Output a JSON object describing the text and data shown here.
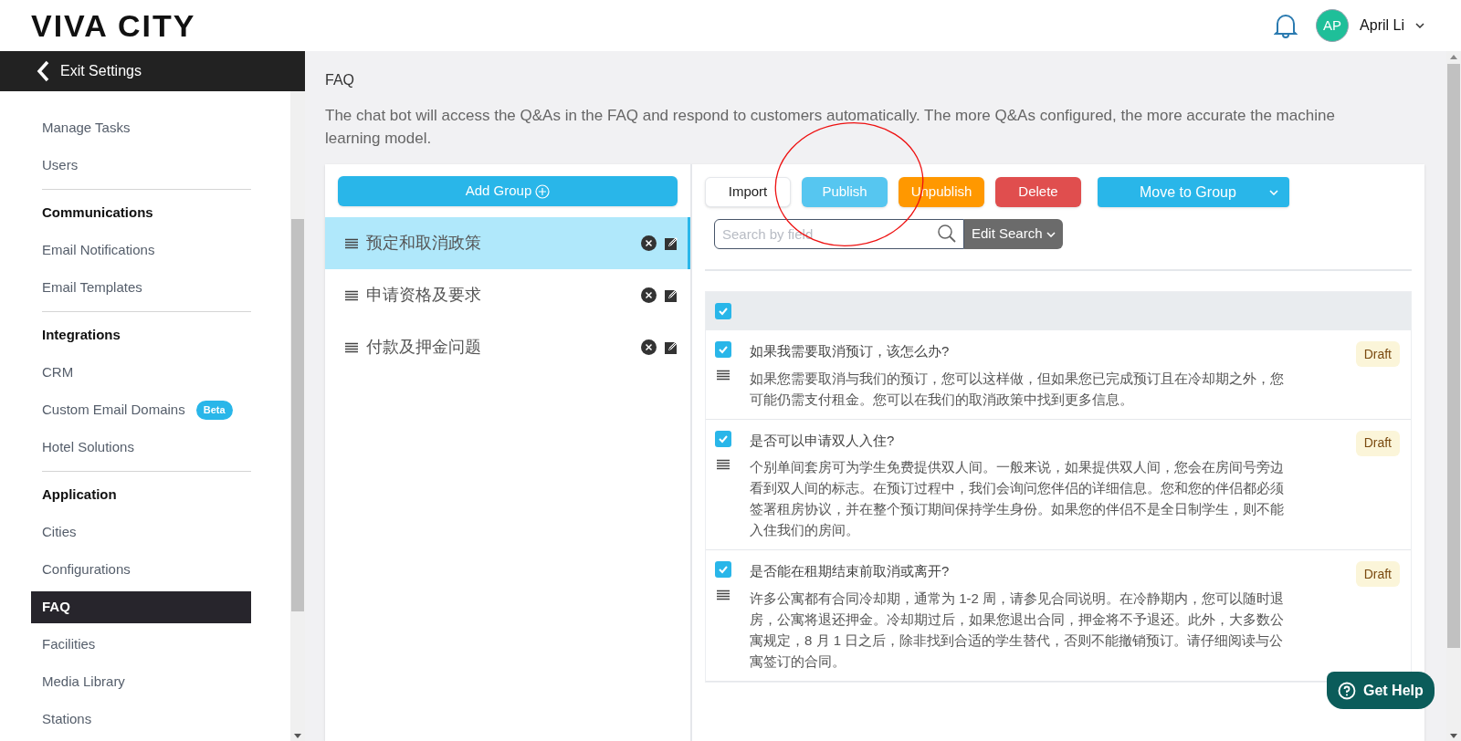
{
  "header": {
    "logo": "VIVA CITY",
    "user": {
      "initials": "AP",
      "name": "April Li"
    }
  },
  "sidebar": {
    "back": "Exit Settings",
    "items": [
      {
        "kind": "item",
        "label": "Manage Tasks",
        "selected": false
      },
      {
        "kind": "item",
        "label": "Users",
        "selected": false
      },
      {
        "kind": "divider"
      },
      {
        "kind": "heading",
        "label": "Communications"
      },
      {
        "kind": "item",
        "label": "Email Notifications",
        "selected": false
      },
      {
        "kind": "item",
        "label": "Email Templates",
        "selected": false
      },
      {
        "kind": "divider"
      },
      {
        "kind": "heading",
        "label": "Integrations"
      },
      {
        "kind": "item",
        "label": "CRM",
        "selected": false
      },
      {
        "kind": "item",
        "label": "Custom Email Domains",
        "badge": "Beta",
        "selected": false
      },
      {
        "kind": "item",
        "label": "Hotel Solutions",
        "selected": false
      },
      {
        "kind": "divider"
      },
      {
        "kind": "heading",
        "label": "Application"
      },
      {
        "kind": "item",
        "label": "Cities",
        "selected": false
      },
      {
        "kind": "item",
        "label": "Configurations",
        "selected": false
      },
      {
        "kind": "item",
        "label": "FAQ",
        "selected": true
      },
      {
        "kind": "item",
        "label": "Facilities",
        "selected": false
      },
      {
        "kind": "item",
        "label": "Media Library",
        "selected": false
      },
      {
        "kind": "item",
        "label": "Stations",
        "selected": false
      }
    ]
  },
  "page": {
    "title": "FAQ",
    "description": "The chat bot will access the Q&As in the FAQ and respond to customers automatically. The more Q&As configured, the more accurate the machine learning model."
  },
  "groups": {
    "add_button": "Add Group",
    "items": [
      {
        "label": "预定和取消政策",
        "selected": true
      },
      {
        "label": "申请资格及要求",
        "selected": false
      },
      {
        "label": "付款及押金问题",
        "selected": false
      }
    ]
  },
  "toolbar": {
    "buttons": [
      {
        "kind": "import",
        "label": "Import"
      },
      {
        "kind": "publish",
        "label": "Publish"
      },
      {
        "kind": "unpublish",
        "label": "Unpublish"
      },
      {
        "kind": "delete",
        "label": "Delete"
      }
    ],
    "move_to_group": "Move to Group",
    "search": {
      "placeholder": "Search by field"
    },
    "edit_search": "Edit Search"
  },
  "select_all": {
    "checked": true
  },
  "faqs": [
    {
      "checked": true,
      "question": "如果我需要取消预订，该怎么办?",
      "answer": "如果您需要取消与我们的预订，您可以这样做，但如果您已完成预订且在冷却期之外，您可能仍需支付租金。您可以在我们的取消政策中找到更多信息。",
      "status": "Draft"
    },
    {
      "checked": true,
      "question": "是否可以申请双人入住?",
      "answer": "个别单间套房可为学生免费提供双人间。一般来说，如果提供双人间，您会在房间号旁边看到双人间的标志。在预订过程中，我们会询问您伴侣的详细信息。您和您的伴侣都必须签署租房协议，并在整个预订期间保持学生身份。如果您的伴侣不是全日制学生，则不能入住我们的房间。",
      "status": "Draft"
    },
    {
      "checked": true,
      "question": "是否能在租期结束前取消或离开?",
      "answer": "许多公寓都有合同冷却期，通常为 1-2 周，请参见合同说明。在冷静期内，您可以随时退房，公寓将退还押金。冷却期过后，如果您退出合同，押金将不予退还。此外，大多数公寓规定，8 月 1 日之后，除非找到合适的学生替代，否则不能撤销预订。请仔细阅读与公寓签订的合同。",
      "status": "Draft"
    }
  ],
  "help_button": "Get Help"
}
